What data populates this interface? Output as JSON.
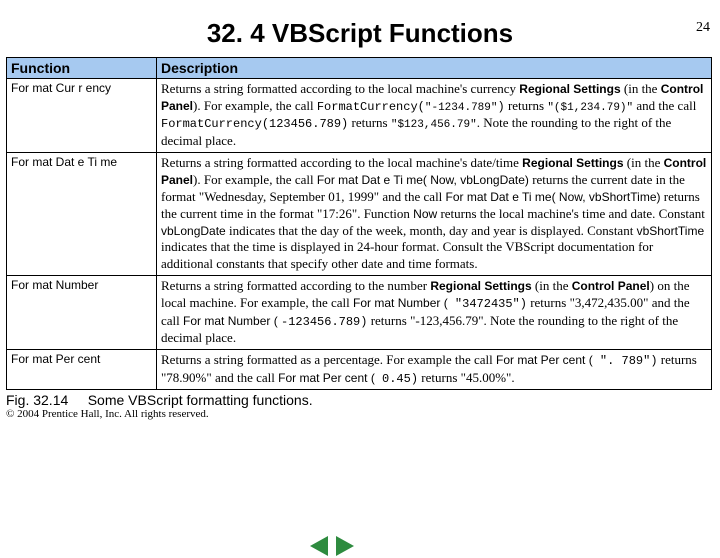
{
  "page_number": "24",
  "title": "32. 4 VBScript Functions",
  "header": {
    "col1": "Function",
    "col2": "Description"
  },
  "rows": {
    "r0": {
      "name": "For mat Cur r ency",
      "d": {
        "t1": "Returns a string formatted according to the local machine's currency ",
        "bold1": "Regional Settings",
        "t2": " (in the ",
        "bold2": "Control Panel",
        "t3": "). For example, the call ",
        "code1": "FormatCurrency(",
        "str1": "\"-1234.789\"",
        "code1b": ")",
        "t4": " returns ",
        "str2": "\"($1,234.79)\"",
        "t5": " and the call ",
        "code2": "FormatCurrency(",
        "num1": "123456.789",
        "code2b": ")",
        "t6": " returns ",
        "str3": "\"$123,456.79\"",
        "t7": ". Note the rounding to the right of the decimal place."
      }
    },
    "r1": {
      "name": "For mat Dat e Ti me",
      "d": {
        "t1": "Returns a string formatted according to the local machine's date/time ",
        "bold1": "Regional Settings",
        "t2": " (in the ",
        "bold2": "Control Panel",
        "t3": "). For example, the call ",
        "code1": "For mat Dat e Ti me( Now, vbLongDate)",
        "t4": " returns the current date in the format ",
        "str1": "\"Wednesday, September 01, 1999\"",
        "t5": " and the call ",
        "code2": "For mat Dat e Ti me( Now,  vbShortTime)",
        "t6": " returns the current time in the format ",
        "str2": "\"17:26\"",
        "t7": ". Function ",
        "code3": "Now",
        "t8": " returns the local machine's time and date. Constant ",
        "code4": "vbLongDate",
        "t9": " indicates that the day of the week, month, day and year is displayed. Constant ",
        "code5": "vbShortTime",
        "t10": " indicates that the time is displayed in 24-hour format. Consult the VBScript documentation for additional constants that specify other date and time formats."
      }
    },
    "r2": {
      "name": "For mat Number",
      "d": {
        "t1": "Returns a string formatted according to the number ",
        "bold1": "Regional Settings",
        "t2": " (in the ",
        "bold2": "Control Panel",
        "t3": ") on the local machine. For example, the call ",
        "code1": "For mat Number (",
        "str1": " \"3472435\")",
        "t4": " returns ",
        "str2": "\"3,472,435.00\"",
        "t5": " and the call ",
        "code2": "For mat Number ( ",
        "num1": "-123456.789)",
        "t6": " returns ",
        "str3": "\"-123,456.79\"",
        "t7": ". Note the rounding to the right of the decimal place."
      }
    },
    "r3": {
      "name": "For mat Per cent",
      "d": {
        "t1": "Returns a string formatted as a percentage. For example the call ",
        "code1": "For mat Per cent (",
        "str1": " \". 789\")",
        "t2": " returns ",
        "str2": "\"78.90%\"",
        "t3": " and the call ",
        "code2": "For mat Per cent (",
        "num1": " 0.45)",
        "t4": " returns ",
        "str3": "\"45.00%\"",
        "t5": "."
      }
    }
  },
  "caption": {
    "fig": "Fig. 32.14",
    "text": "Some VBScript formatting functions."
  },
  "copyright": "© 2004 Prentice Hall, Inc.  All rights reserved."
}
